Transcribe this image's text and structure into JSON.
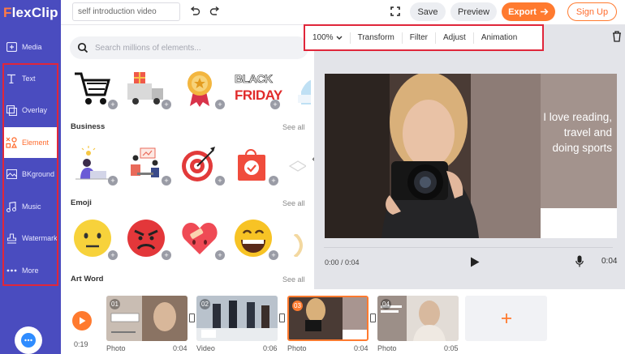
{
  "app": {
    "logo_text": "FlexClip"
  },
  "sidebar": {
    "items": [
      {
        "label": "Media",
        "icon": "media-icon"
      },
      {
        "label": "Text",
        "icon": "text-icon"
      },
      {
        "label": "Overlay",
        "icon": "overlay-icon"
      },
      {
        "label": "Element",
        "icon": "element-icon",
        "active": true
      },
      {
        "label": "BKground",
        "icon": "background-icon"
      },
      {
        "label": "Music",
        "icon": "music-icon"
      },
      {
        "label": "Watermark",
        "icon": "watermark-icon"
      },
      {
        "label": "More",
        "icon": "more-icon"
      }
    ]
  },
  "header": {
    "project_title": "self introduction video",
    "save_label": "Save",
    "preview_label": "Preview",
    "export_label": "Export",
    "signup_label": "Sign Up"
  },
  "panel": {
    "search_placeholder": "Search millions of elements...",
    "sections": [
      {
        "label": "Business",
        "see_all": "See all"
      },
      {
        "label": "Emoji",
        "see_all": "See all"
      },
      {
        "label": "Art Word",
        "see_all": "See all"
      }
    ],
    "art_word_text_1": "BLACK",
    "art_word_text_2": "FRIDAY"
  },
  "editor": {
    "toolbar": {
      "zoom": "100%",
      "transform": "Transform",
      "filter": "Filter",
      "adjust": "Adjust",
      "animation": "Animation"
    },
    "canvas_text_line1": "I love reading,",
    "canvas_text_line2": "travel and",
    "canvas_text_line3": "doing sports",
    "current_time": "0:00 / 0:04",
    "duration": "0:04"
  },
  "timeline": {
    "total_time": "0:19",
    "clips": [
      {
        "num": "01",
        "type": "Photo",
        "duration": "0:04"
      },
      {
        "num": "02",
        "type": "Video",
        "duration": "0:06"
      },
      {
        "num": "03",
        "type": "Photo",
        "duration": "0:04",
        "selected": true
      },
      {
        "num": "04",
        "type": "Photo",
        "duration": "0:05"
      }
    ]
  },
  "colors": {
    "sidebar_bg": "#4a4cbf",
    "accent": "#ff7a2f",
    "highlight_red": "#e0263a"
  }
}
